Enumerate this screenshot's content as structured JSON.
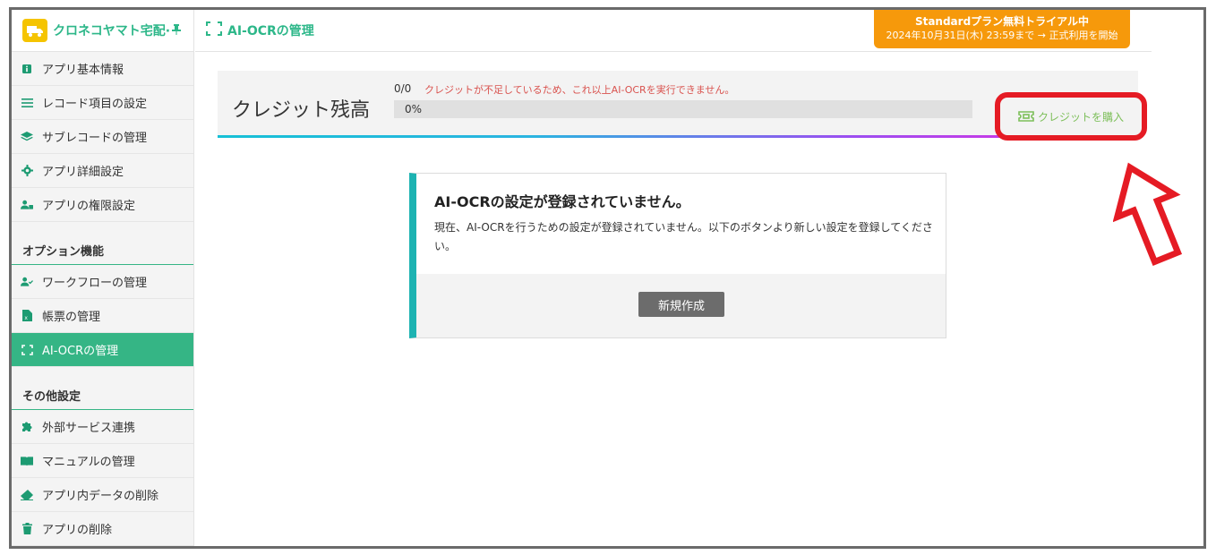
{
  "app": {
    "name": "クロネコヤマト宅配·",
    "pin_glyph": "📌"
  },
  "sidebar": {
    "items_top": [
      {
        "label": "アプリ基本情報",
        "icon": "info-icon"
      },
      {
        "label": "レコード項目の設定",
        "icon": "list-icon"
      },
      {
        "label": "サブレコードの管理",
        "icon": "layers-icon"
      },
      {
        "label": "アプリ詳細設定",
        "icon": "gear-icon"
      },
      {
        "label": "アプリの権限設定",
        "icon": "user-lock-icon"
      }
    ],
    "section_options": "オプション機能",
    "items_options": [
      {
        "label": "ワークフローの管理",
        "icon": "user-check-icon"
      },
      {
        "label": "帳票の管理",
        "icon": "excel-file-icon"
      },
      {
        "label": "AI-OCRの管理",
        "icon": "scan-frame-icon",
        "active": true
      }
    ],
    "section_other": "その他設定",
    "items_other": [
      {
        "label": "外部サービス連携",
        "icon": "puzzle-icon"
      },
      {
        "label": "マニュアルの管理",
        "icon": "book-icon"
      },
      {
        "label": "アプリ内データの削除",
        "icon": "eraser-icon"
      },
      {
        "label": "アプリの削除",
        "icon": "trash-icon"
      }
    ]
  },
  "header": {
    "title": "AI-OCRの管理"
  },
  "trial_banner": {
    "line1": "Standardプラン無料トライアル中",
    "line2": "2024年10月31日(木) 23:59まで → 正式利用を開始",
    "color": "#f6990b"
  },
  "credit": {
    "title": "クレジット残高",
    "count": "0/0",
    "warning": "クレジットが不足しているため、これ以上AI-OCRを実行できません。",
    "progress_label": "0%",
    "progress_fraction": 0,
    "buy_label": "クレジットを購入"
  },
  "notice": {
    "title": "AI-OCRの設定が登録されていません。",
    "text": "現在、AI-OCRを行うための設定が登録されていません。以下のボタンより新しい設定を登録してください。",
    "button": "新規作成"
  },
  "colors": {
    "brand_green": "#2db789",
    "active_bg": "#35b585",
    "warning_red": "#d9534f",
    "highlight_red": "#e51b24",
    "card_accent": "#1db3b2"
  }
}
